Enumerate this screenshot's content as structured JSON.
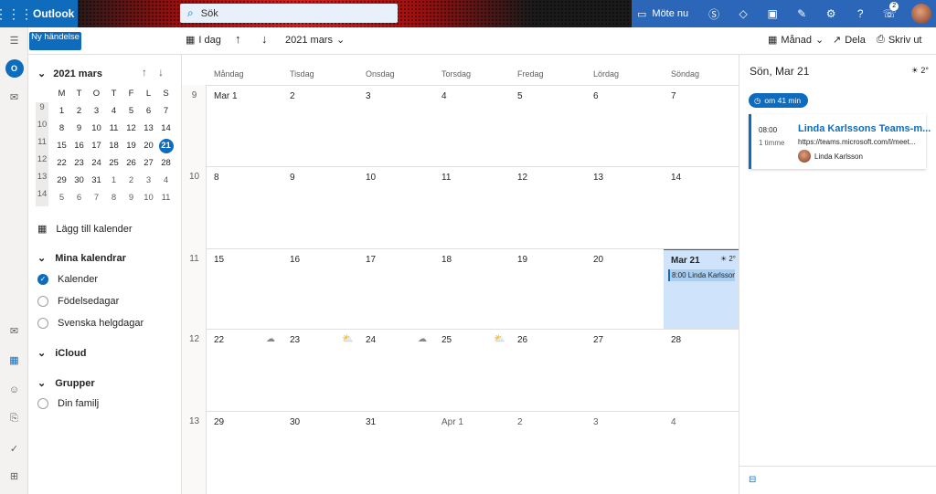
{
  "app": {
    "name": "Outlook"
  },
  "search": {
    "placeholder": "Sök"
  },
  "topbar": {
    "meet_now": "Möte nu",
    "notification_count": "2"
  },
  "toolbar": {
    "new_event": "Ny händelse",
    "day_view": "I dag",
    "month_label": "2021 mars",
    "view_label": "Månad",
    "share": "Dela",
    "print": "Skriv ut"
  },
  "mini_calendar": {
    "title": "2021 mars",
    "weekdays": [
      "M",
      "T",
      "O",
      "T",
      "F",
      "L",
      "S"
    ],
    "weeks": [
      {
        "wk": "9",
        "days": [
          "1",
          "2",
          "3",
          "4",
          "5",
          "6",
          "7"
        ]
      },
      {
        "wk": "10",
        "days": [
          "8",
          "9",
          "10",
          "11",
          "12",
          "13",
          "14"
        ]
      },
      {
        "wk": "11",
        "days": [
          "15",
          "16",
          "17",
          "18",
          "19",
          "20",
          "21"
        ]
      },
      {
        "wk": "12",
        "days": [
          "22",
          "23",
          "24",
          "25",
          "26",
          "27",
          "28"
        ]
      },
      {
        "wk": "13",
        "days": [
          "29",
          "30",
          "31",
          "1",
          "2",
          "3",
          "4"
        ]
      },
      {
        "wk": "14",
        "days": [
          "5",
          "6",
          "7",
          "8",
          "9",
          "10",
          "11"
        ]
      }
    ],
    "selected": "21"
  },
  "sidebar": {
    "add_calendar": "Lägg till kalender",
    "my_calendars": "Mina kalendrar",
    "calendars": [
      "Kalender",
      "Födelsedagar",
      "Svenska helgdagar"
    ],
    "icloud": "iCloud",
    "groups": "Grupper",
    "group_items": [
      "Din familj"
    ]
  },
  "month": {
    "weekdays": [
      "Måndag",
      "Tisdag",
      "Onsdag",
      "Torsdag",
      "Fredag",
      "Lördag",
      "Söndag"
    ],
    "weeks": [
      {
        "wk": "9",
        "days": [
          "Mar 1",
          "2",
          "3",
          "4",
          "5",
          "6",
          "7"
        ]
      },
      {
        "wk": "10",
        "days": [
          "8",
          "9",
          "10",
          "11",
          "12",
          "13",
          "14"
        ]
      },
      {
        "wk": "11",
        "days": [
          "15",
          "16",
          "17",
          "18",
          "19",
          "20",
          "Mar 21"
        ]
      },
      {
        "wk": "12",
        "days": [
          "22",
          "23",
          "24",
          "25",
          "26",
          "27",
          "28"
        ]
      },
      {
        "wk": "13",
        "days": [
          "29",
          "30",
          "31",
          "Apr 1",
          "2",
          "3",
          "4"
        ]
      }
    ],
    "today_weather": "2°",
    "today_event": "8:00 Linda Karlsson"
  },
  "right_pane": {
    "title": "Sön, Mar 21",
    "weather": "2°",
    "countdown": "om 41 min",
    "event": {
      "time": "08:00",
      "duration": "1 timme",
      "title": "Linda Karlssons Teams-m...",
      "url": "https://teams.microsoft.com/l/meet...",
      "organizer": "Linda Karlsson"
    }
  },
  "colors": {
    "accent": "#0f6cbd",
    "today_bg": "#cfe4fa"
  }
}
